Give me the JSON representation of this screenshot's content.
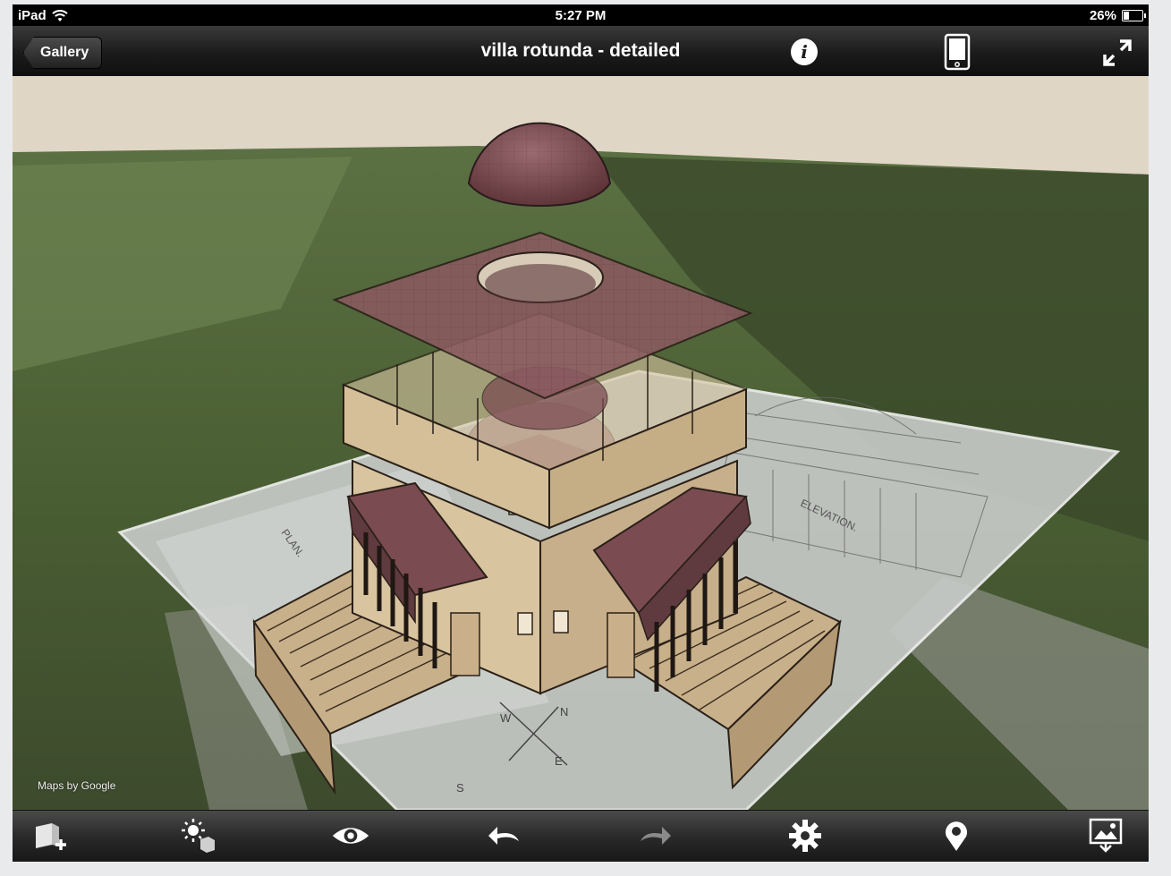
{
  "status_bar": {
    "device": "iPad",
    "time": "5:27 PM",
    "battery": "26%"
  },
  "nav_bar": {
    "back_label": "Gallery",
    "title": "villa rotunda - detailed",
    "info_label": "i",
    "icons": [
      "info-icon",
      "device-icon",
      "expand-icon"
    ]
  },
  "viewport": {
    "maps_credit": "Maps by Google",
    "drawing_labels": [
      "PLAN.",
      "ELEVATION."
    ],
    "compass": [
      "N",
      "E",
      "S",
      "W"
    ]
  },
  "toolbar": {
    "icons": [
      "add-model-icon",
      "lighting-icon",
      "view-eye-icon",
      "undo-icon",
      "redo-icon",
      "settings-gear-icon",
      "location-pin-icon",
      "screenshot-export-icon"
    ]
  },
  "colors": {
    "bar_dark": "#1b1b1b",
    "roof": "#8a5a60",
    "wall": "#d7c4a1",
    "sky": "#dfd6c6"
  }
}
